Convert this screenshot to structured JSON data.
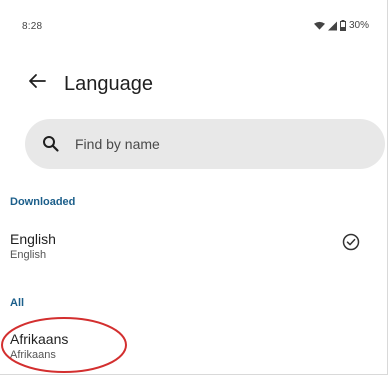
{
  "status_bar": {
    "time": "8:28",
    "battery": "30%",
    "icons": [
      "wifi-icon",
      "signal-icon",
      "battery-icon"
    ]
  },
  "app_bar": {
    "title": "Language",
    "back_icon": "arrow-back-icon"
  },
  "search": {
    "placeholder": "Find by name",
    "icon": "search-icon"
  },
  "sections": {
    "downloaded_label": "Downloaded",
    "all_label": "All"
  },
  "languages": {
    "downloaded": [
      {
        "name": "English",
        "native": "English",
        "installed": true
      }
    ],
    "all": [
      {
        "name": "Afrikaans",
        "native": "Afrikaans",
        "installed": false
      }
    ]
  },
  "colors": {
    "section_header": "#1b5e8a",
    "search_bg": "#e8e8e8",
    "annotation": "#d32f2f"
  }
}
